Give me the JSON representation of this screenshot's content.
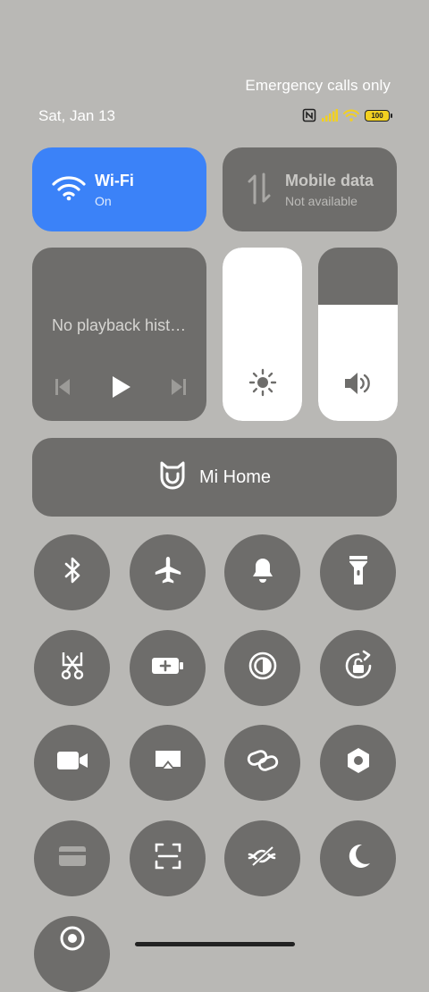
{
  "status": {
    "carrier_text": "Emergency calls only",
    "date": "Sat, Jan 13",
    "battery_level": "100",
    "icons": [
      "nfc-icon",
      "signal-icon",
      "wifi-icon",
      "battery-icon"
    ]
  },
  "wifi": {
    "title": "Wi-Fi",
    "state": "On",
    "color": "#3b82f8"
  },
  "mobile": {
    "title": "Mobile data",
    "state": "Not available"
  },
  "media": {
    "text": "No playback hist…"
  },
  "sliders": {
    "brightness_level": 1.0,
    "volume_level": 0.67
  },
  "mihome": {
    "label": "Mi Home"
  },
  "toggles": [
    "bluetooth-icon",
    "airplane-icon",
    "bell-icon",
    "flashlight-icon",
    "scissors-icon",
    "battery-saver-icon",
    "reading-mode-icon",
    "rotation-lock-icon",
    "video-camera-icon",
    "screencast-icon",
    "link-icon",
    "settings-hexagon-icon",
    "card-icon",
    "scan-icon",
    "sync-icon",
    "moon-icon",
    "cast-icon"
  ],
  "colors": {
    "background": "#b9b8b5",
    "tile": "#6e6d6b",
    "accent": "#3b82f8"
  }
}
